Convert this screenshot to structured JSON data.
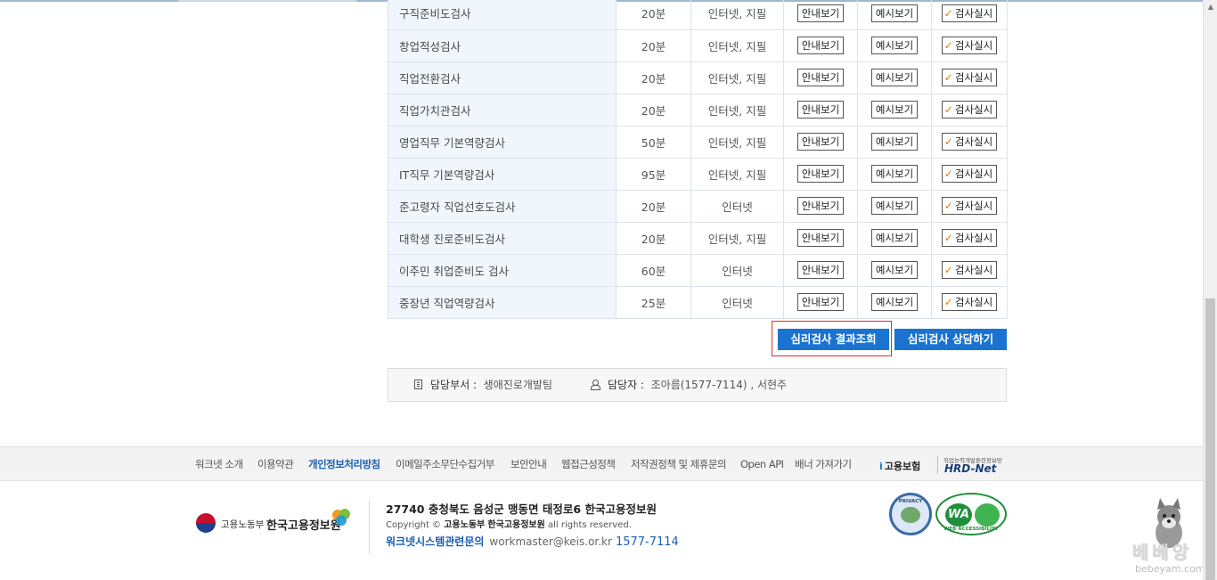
{
  "exams": [
    {
      "name": "구직준비도검사",
      "time": "20분",
      "method": "인터넷, 지필"
    },
    {
      "name": "창업적성검사",
      "time": "20분",
      "method": "인터넷, 지필"
    },
    {
      "name": "직업전환검사",
      "time": "20분",
      "method": "인터넷, 지필"
    },
    {
      "name": "직업가치관검사",
      "time": "20분",
      "method": "인터넷, 지필"
    },
    {
      "name": "영업직무 기본역량검사",
      "time": "50분",
      "method": "인터넷, 지필"
    },
    {
      "name": "IT직무 기본역량검사",
      "time": "95분",
      "method": "인터넷, 지필"
    },
    {
      "name": "준고령자 직업선호도검사",
      "time": "20분",
      "method": "인터넷"
    },
    {
      "name": "대학생 진로준비도검사",
      "time": "20분",
      "method": "인터넷, 지필"
    },
    {
      "name": "이주민 취업준비도 검사",
      "time": "60분",
      "method": "인터넷"
    },
    {
      "name": "중장년 직업역량검사",
      "time": "25분",
      "method": "인터넷"
    }
  ],
  "buttons": {
    "guide": "안내보기",
    "sample": "예시보기",
    "run": "검사실시",
    "check_mark": "✓",
    "result": "심리검사 결과조회",
    "consult": "심리검사 상담하기"
  },
  "contact": {
    "dept_label": "담당부서 :",
    "dept_value": "생애진로개발팀",
    "person_label": "담당자 :",
    "person_value": "조아름(1577-7114) , 서현주"
  },
  "footer_nav": {
    "items": [
      "워크넷 소개",
      "이용약관",
      "개인정보처리방침",
      "이메일주소무단수집거부",
      "보안안내",
      "웹접근성정책",
      "저작권정책 및 제휴문의",
      "Open API",
      "배너 가져가기"
    ],
    "employment_logo": "고용보험",
    "employment_mark": "i",
    "hrd_small": "직업능력개발훈련정보망",
    "hrd_logo": "HRD-Net"
  },
  "footer": {
    "ministry": "고용노동부",
    "org": "한국고용정보원",
    "address": "27740 충청북도 음성군 맹동면 태정로6 한국고용정보원",
    "copyright_prefix": "Copyright ©",
    "copyright_ministry": "고용노동부",
    "copyright_org": "한국고용정보원",
    "copyright_suffix": "all rights reserved.",
    "inquiry_label": "워크넷시스템관련문의",
    "email": "workmaster@keis.or.kr",
    "phone": "1577-7114",
    "privacy_badge": "PRIVACY",
    "wa_badge": "WA",
    "wa_sub": "WEB ACCESSIBILITY"
  },
  "watermark": {
    "text": "베베앙",
    "url": "bebeyam.com"
  },
  "colors": {
    "accent_blue": "#1a73d1",
    "highlight_red": "#d9322f",
    "check_orange": "#e07a14"
  }
}
